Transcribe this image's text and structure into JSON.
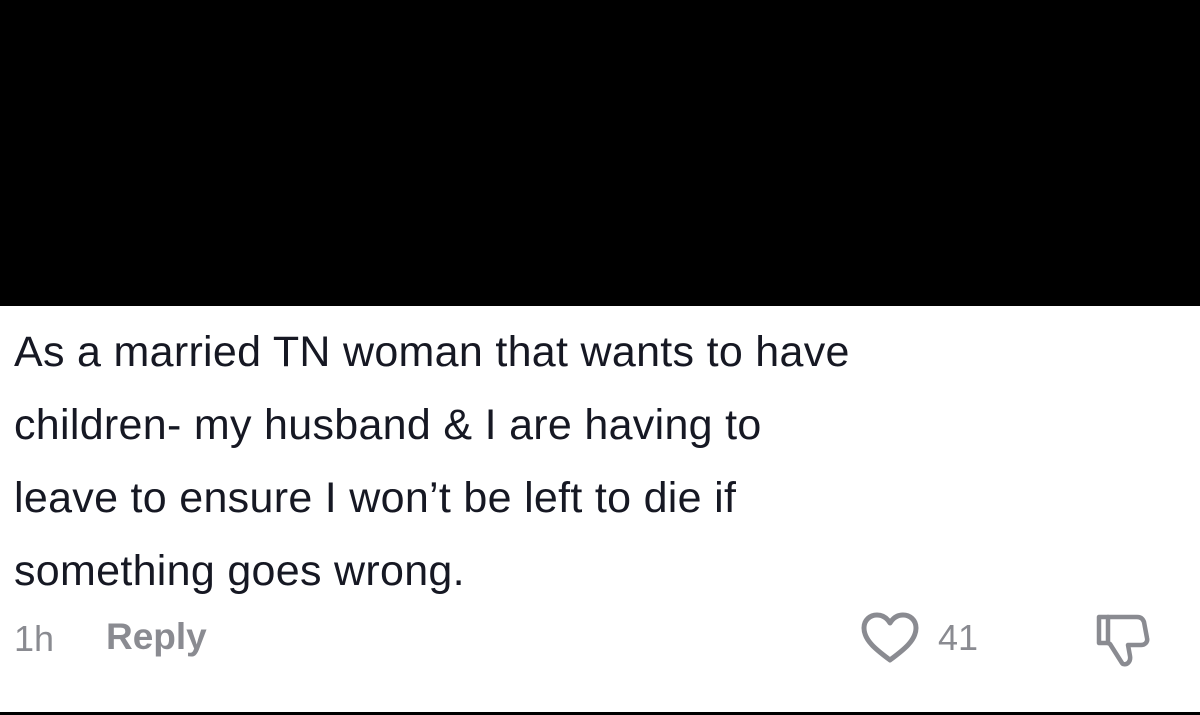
{
  "comment": {
    "lines": [
      "As a married TN woman that wants to have",
      "children- my husband & I are having to",
      "leave to ensure I won’t be left to die if",
      "something goes wrong."
    ],
    "timestamp": "1h",
    "reply_label": "Reply",
    "like_count": "41"
  },
  "icons": {
    "like": "heart-outline-icon",
    "dislike": "thumbs-down-outline-icon"
  },
  "colors": {
    "text": "#161823",
    "muted": "#8a8b91",
    "redaction": "#000000"
  }
}
